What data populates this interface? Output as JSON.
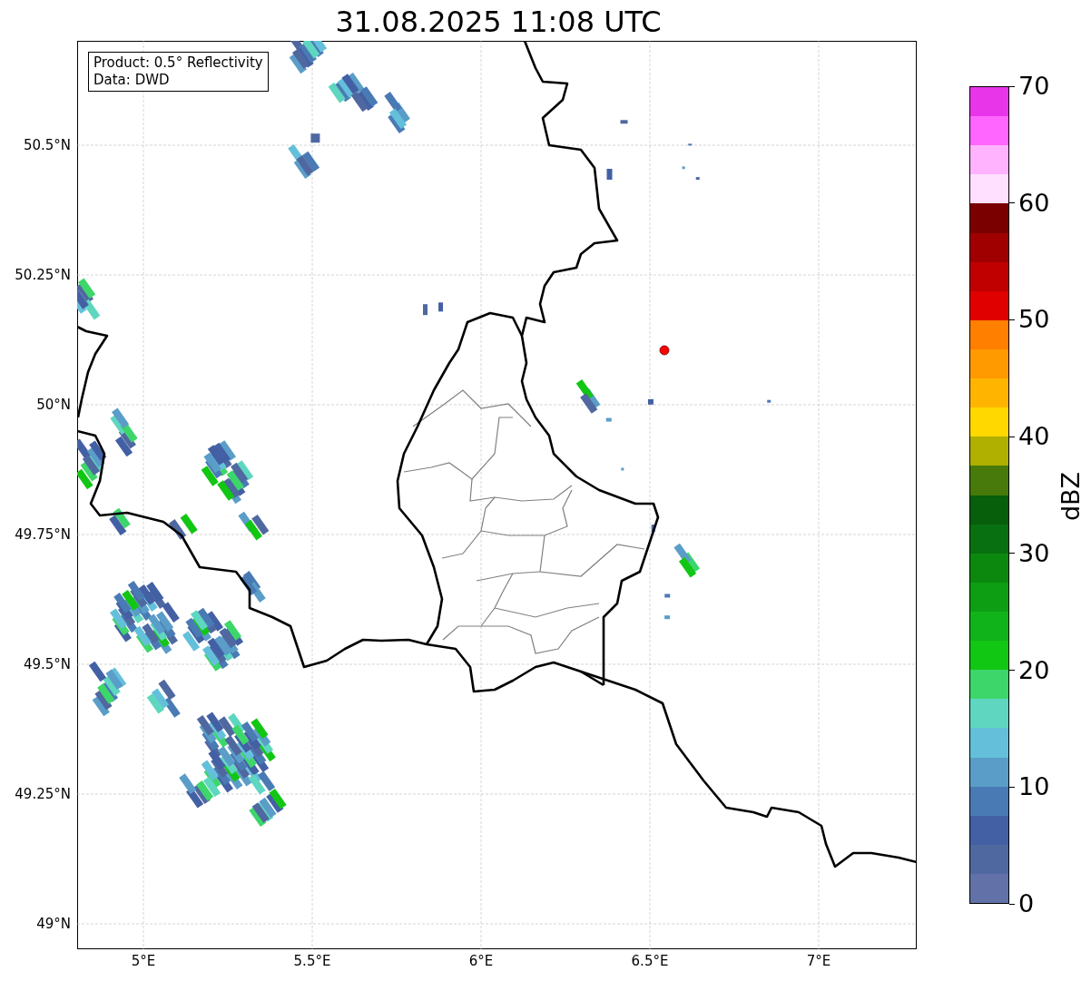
{
  "title": "31.08.2025 11:08 UTC",
  "info_box": [
    "Product: 0.5° Reflectivity",
    "Data: DWD"
  ],
  "map": {
    "lon_labels": [
      "5°E",
      "5.5°E",
      "6°E",
      "6.5°E",
      "7°E"
    ],
    "lat_labels": [
      "50.5°N",
      "50.25°N",
      "50°N",
      "49.75°N",
      "49.5°N",
      "49.25°N",
      "49°N"
    ]
  },
  "colorbar": {
    "label": "dBZ",
    "ticks": [
      "70",
      "60",
      "50",
      "40",
      "30",
      "20",
      "10",
      "0"
    ],
    "segments": [
      {
        "color": "#e935e9"
      },
      {
        "color": "#ff66ff"
      },
      {
        "color": "#ffb3ff"
      },
      {
        "color": "#ffe0ff"
      },
      {
        "color": "#7a0000"
      },
      {
        "color": "#a00000"
      },
      {
        "color": "#c00000"
      },
      {
        "color": "#e00000"
      },
      {
        "color": "#ff7f00"
      },
      {
        "color": "#ff9a00"
      },
      {
        "color": "#ffb500"
      },
      {
        "color": "#ffd800"
      },
      {
        "color": "#b0b000"
      },
      {
        "color": "#477a0b"
      },
      {
        "color": "#075e0b"
      },
      {
        "color": "#087010"
      },
      {
        "color": "#0c880f"
      },
      {
        "color": "#0e9e14"
      },
      {
        "color": "#10b41a"
      },
      {
        "color": "#12c614"
      },
      {
        "color": "#3dd66b"
      },
      {
        "color": "#5fd6c0"
      },
      {
        "color": "#64c0da"
      },
      {
        "color": "#5a9dc8"
      },
      {
        "color": "#4a7ab4"
      },
      {
        "color": "#4360a4"
      },
      {
        "color": "#5068a0"
      },
      {
        "color": "#6272a8"
      }
    ]
  }
}
